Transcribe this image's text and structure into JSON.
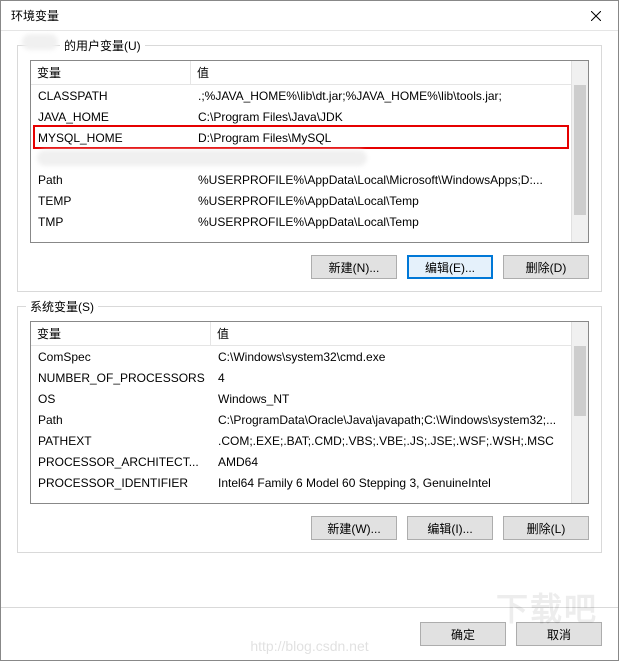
{
  "window": {
    "title": "环境变量"
  },
  "user_section": {
    "label": "的用户变量(U)",
    "headers": {
      "name": "变量",
      "value": "值"
    },
    "col_widths": {
      "name": 160,
      "value": 380
    },
    "rows": [
      {
        "name": "CLASSPATH",
        "value": ".;%JAVA_HOME%\\lib\\dt.jar;%JAVA_HOME%\\lib\\tools.jar;"
      },
      {
        "name": "JAVA_HOME",
        "value": "C:\\Program Files\\Java\\JDK"
      },
      {
        "name": "MYSQL_HOME",
        "value": "D:\\Program Files\\MySQL"
      },
      {
        "name": "",
        "value": ""
      },
      {
        "name": "Path",
        "value": "%USERPROFILE%\\AppData\\Local\\Microsoft\\WindowsApps;D:..."
      },
      {
        "name": "TEMP",
        "value": "%USERPROFILE%\\AppData\\Local\\Temp"
      },
      {
        "name": "TMP",
        "value": "%USERPROFILE%\\AppData\\Local\\Temp"
      }
    ],
    "highlight_index": 2,
    "buttons": {
      "new": "新建(N)...",
      "edit": "编辑(E)...",
      "delete": "删除(D)"
    }
  },
  "system_section": {
    "label": "系统变量(S)",
    "headers": {
      "name": "变量",
      "value": "值"
    },
    "col_widths": {
      "name": 180,
      "value": 360
    },
    "rows": [
      {
        "name": "ComSpec",
        "value": "C:\\Windows\\system32\\cmd.exe"
      },
      {
        "name": "NUMBER_OF_PROCESSORS",
        "value": "4"
      },
      {
        "name": "OS",
        "value": "Windows_NT"
      },
      {
        "name": "Path",
        "value": "C:\\ProgramData\\Oracle\\Java\\javapath;C:\\Windows\\system32;..."
      },
      {
        "name": "PATHEXT",
        "value": ".COM;.EXE;.BAT;.CMD;.VBS;.VBE;.JS;.JSE;.WSF;.WSH;.MSC"
      },
      {
        "name": "PROCESSOR_ARCHITECT...",
        "value": "AMD64"
      },
      {
        "name": "PROCESSOR_IDENTIFIER",
        "value": "Intel64 Family 6 Model 60 Stepping 3, GenuineIntel"
      }
    ],
    "buttons": {
      "new": "新建(W)...",
      "edit": "编辑(I)...",
      "delete": "删除(L)"
    }
  },
  "bottom": {
    "ok": "确定",
    "cancel": "取消"
  },
  "watermark": "下载吧",
  "watermark2": "http://blog.csdn.net"
}
